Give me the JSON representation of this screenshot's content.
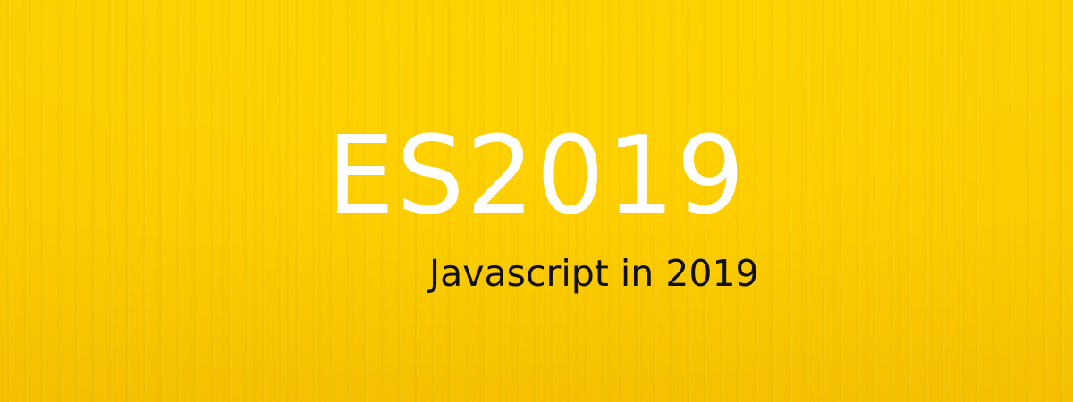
{
  "banner": {
    "title": "ES2019",
    "subtitle": "Javascript in 2019",
    "background_color": "#ffd400",
    "title_color": "#ffffff",
    "subtitle_color": "#111111"
  }
}
